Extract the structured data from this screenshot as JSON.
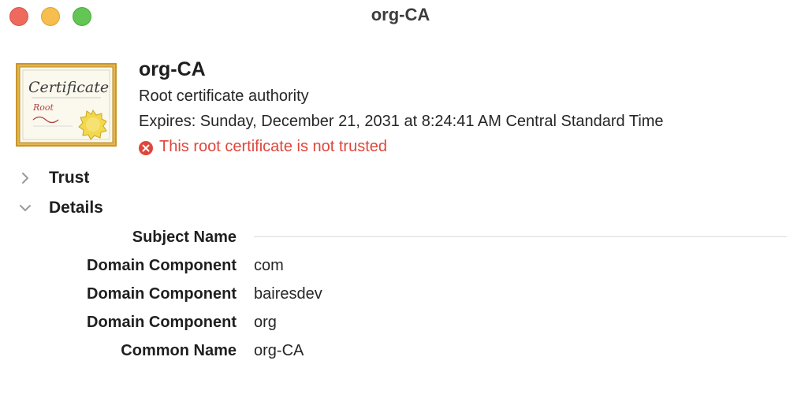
{
  "window": {
    "title": "org-CA",
    "controls": [
      "close",
      "minimize",
      "zoom"
    ]
  },
  "certificate": {
    "image": {
      "icon": "certificate-icon",
      "script_text": "Certificate",
      "subtext": "Root",
      "frame_color": "#c9962d",
      "seal_color": "#f2d84a"
    },
    "name": "org-CA",
    "kind": "Root certificate authority",
    "expires": "Expires: Sunday, December 21, 2031 at 8:24:41 AM Central Standard Time",
    "warning": {
      "icon": "error-circle-icon",
      "text": "This root certificate is not trusted",
      "color": "#e0453a"
    }
  },
  "sections": {
    "trust": {
      "label": "Trust",
      "expanded": false,
      "icon": "chevron-right-icon"
    },
    "details": {
      "label": "Details",
      "expanded": true,
      "icon": "chevron-down-icon"
    }
  },
  "details": {
    "subject_heading": "Subject Name",
    "fields": [
      {
        "label": "Domain Component",
        "value": "com"
      },
      {
        "label": "Domain Component",
        "value": "bairesdev"
      },
      {
        "label": "Domain Component",
        "value": "org"
      },
      {
        "label": "Common Name",
        "value": "org-CA"
      }
    ]
  }
}
